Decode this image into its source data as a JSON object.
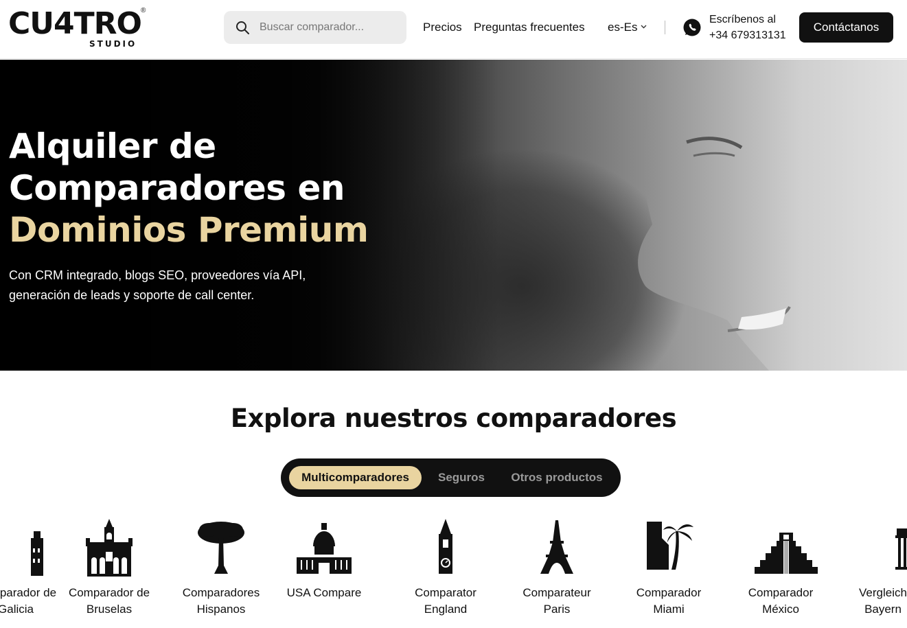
{
  "header": {
    "logo": {
      "main": "CU4TRO",
      "registered": "®",
      "sub": "STUDIO"
    },
    "search": {
      "placeholder": "Buscar comparador...",
      "value": ""
    },
    "nav": [
      {
        "label": "Precios"
      },
      {
        "label": "Preguntas frecuentes"
      }
    ],
    "language": {
      "selected": "es-Es"
    },
    "whatsapp": {
      "line1": "Escríbenos al",
      "line2": "+34 679313131",
      "icon": "whatsapp-icon"
    },
    "contact_button": "Contáctanos"
  },
  "hero": {
    "title_line1": "Alquiler de",
    "title_line2": "Comparadores en",
    "title_highlight": "Dominios Premium",
    "subtitle": "Con CRM integrado, blogs SEO, proveedores vía API, generación de leads y soporte de call center."
  },
  "explore": {
    "title": "Explora nuestros comparadores",
    "tabs": [
      {
        "label": "Multicomparadores",
        "active": true
      },
      {
        "label": "Seguros",
        "active": false
      },
      {
        "label": "Otros productos",
        "active": false
      }
    ],
    "items": [
      {
        "label_line1": "Comparador de",
        "label_line2": "Galicia",
        "icon": "building-icon"
      },
      {
        "label_line1": "Comparador de",
        "label_line2": "Bruselas",
        "icon": "brussels-cathedral-icon"
      },
      {
        "label_line1": "Comparadores",
        "label_line2": "Hispanos",
        "icon": "tree-icon"
      },
      {
        "label_line1": "USA Compare",
        "label_line2": "",
        "icon": "capitol-icon"
      },
      {
        "label_line1": "Comparator",
        "label_line2": "England",
        "icon": "big-ben-icon"
      },
      {
        "label_line1": "Comparateur",
        "label_line2": "Paris",
        "icon": "eiffel-tower-icon"
      },
      {
        "label_line1": "Comparador",
        "label_line2": "Miami",
        "icon": "palm-tree-icon"
      },
      {
        "label_line1": "Comparador",
        "label_line2": "México",
        "icon": "pyramid-icon"
      },
      {
        "label_line1": "Vergleich",
        "label_line2": "Bayern",
        "icon": "gate-icon"
      }
    ]
  },
  "colors": {
    "accent_gold": "#e9d4a0",
    "dark": "#111111",
    "search_bg": "#ececec"
  }
}
